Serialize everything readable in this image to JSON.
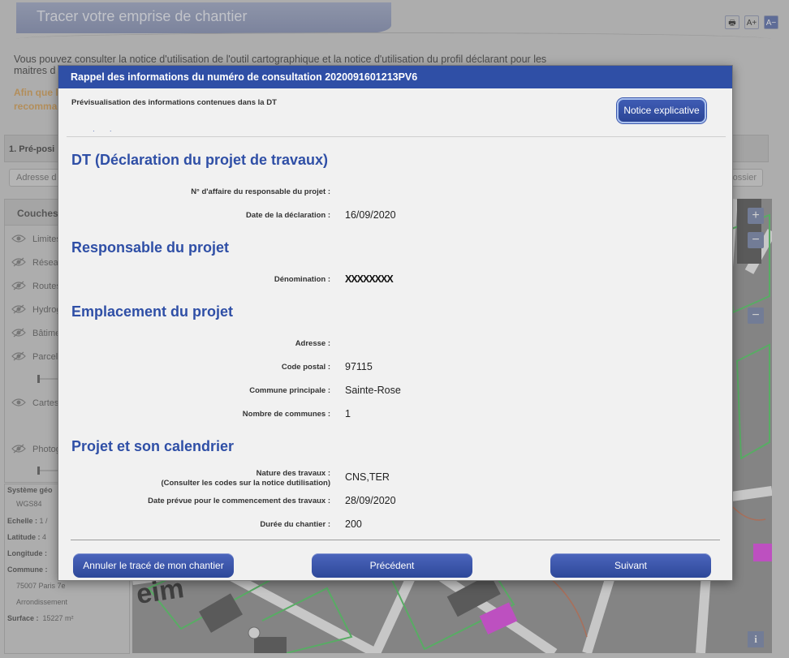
{
  "page": {
    "title": "Tracer votre emprise de chantier",
    "intro": "Vous pouvez consulter la notice d'utilisation de l'outil cartographique et la notice d'utilisation du profil déclarant pour les maitres d",
    "warn_line1": "Afin que l",
    "warn_line2": "recomma",
    "step_label": "1. Pré-posi",
    "address_placeholder": "Adresse d",
    "reset_label": "ossier",
    "tools": {
      "print": "🖶",
      "font_up": "A+",
      "font_down": "A−"
    }
  },
  "layers": {
    "heading": "Couches",
    "items": [
      {
        "label": "Limites",
        "visible": true
      },
      {
        "label": "Réseau",
        "visible": false
      },
      {
        "label": "Routes",
        "visible": false
      },
      {
        "label": "Hydrog",
        "visible": false
      },
      {
        "label": "Bâtime",
        "visible": false
      },
      {
        "label": "Parcell",
        "visible": false
      },
      {
        "label": "Cartes",
        "visible": true
      },
      {
        "label": "Photog",
        "visible": false
      }
    ]
  },
  "map_info": {
    "system_label": "Système géo",
    "system_value": "WGS84",
    "scale_label": "Echelle :",
    "scale_value": "1 /",
    "latitude_label": "Latitude :",
    "latitude_value": "4",
    "longitude_label": "Longitude :",
    "commune_label": "Commune :",
    "commune_line1": "75007 Paris 7e",
    "commune_line2": "Arrondissement",
    "surface_label": "Surface :",
    "surface_value": "15227 m²",
    "map_text": "eim",
    "zoom_in": "+",
    "zoom_out": "−",
    "info": "i"
  },
  "modal": {
    "title": "Rappel des informations du numéro de consultation 2020091601213PV6",
    "preview_label": "Prévisualisation des informations contenues dans la DT",
    "notice_button": "Notice explicative",
    "preview_dots": "· ·",
    "sections": {
      "dt": {
        "title": "DT (Déclaration du projet de travaux)",
        "affaire_label": "N° d'affaire du responsable du projet :",
        "affaire_value": "",
        "date_label": "Date de la déclaration :",
        "date_value": "16/09/2020"
      },
      "responsable": {
        "title": "Responsable du projet",
        "denomination_label": "Dénomination :",
        "denomination_value": "XXXXXXXX"
      },
      "emplacement": {
        "title": "Emplacement du projet",
        "adresse_label": "Adresse :",
        "adresse_value": "",
        "code_postal_label": "Code postal :",
        "code_postal_value": "97115",
        "commune_label": "Commune principale :",
        "commune_value": "Sainte-Rose",
        "nombre_label": "Nombre de communes :",
        "nombre_value": "1"
      },
      "calendrier": {
        "title": "Projet et son calendrier",
        "nature_label_1": "Nature des travaux :",
        "nature_label_2": "(Consulter les codes sur la notice dutilisation)",
        "nature_value": "CNS,TER",
        "debut_label": "Date prévue pour le commencement des travaux :",
        "debut_value": "28/09/2020",
        "duree_label": "Durée du chantier :",
        "duree_value": "200"
      }
    },
    "buttons": {
      "cancel": "Annuler le tracé de mon chantier",
      "previous": "Précédent",
      "next": "Suivant"
    }
  },
  "colors": {
    "brand_blue": "#2f4fa6",
    "warning_orange": "#d39a4b",
    "map_magenta": "#e23be6",
    "map_green": "#3fd24a"
  }
}
